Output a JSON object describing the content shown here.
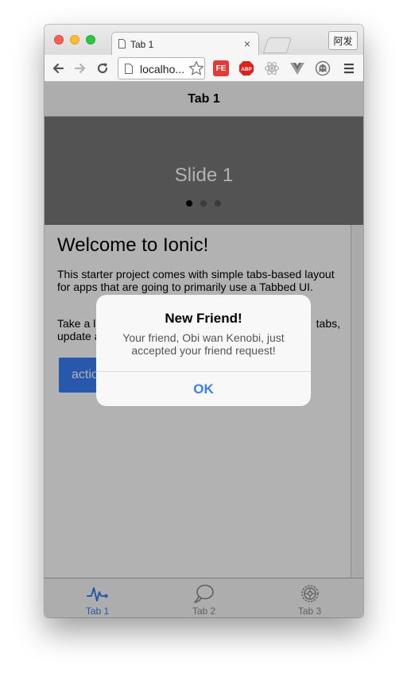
{
  "browser": {
    "tab_title": "Tab 1",
    "tab_close": "×",
    "user_button": "阿发",
    "url": "localho...",
    "ext_fe_label": "FE",
    "ext_abp_label": "ABP"
  },
  "app": {
    "header_title": "Tab 1",
    "slider": {
      "slide_label": "Slide 1",
      "active_index": 0,
      "count": 3
    },
    "content": {
      "heading": "Welcome to Ionic!",
      "paragraph1": "This starter project comes with simple tabs-based layout for apps that are going to primarily use a Tabbed UI.",
      "paragraph2_visible_left": "Take a lo",
      "paragraph2_visible_right": "tabs,",
      "paragraph2_line2_left": "update a",
      "action_button": "actio"
    },
    "tabs": [
      {
        "label": "Tab 1",
        "icon": "pulse-icon",
        "active": true
      },
      {
        "label": "Tab 2",
        "icon": "chat-bubbles-icon",
        "active": false
      },
      {
        "label": "Tab 3",
        "icon": "gear-icon",
        "active": false
      }
    ],
    "colors": {
      "primary": "#387ef5",
      "inactive_tab": "#8c8c8c",
      "slider_bg": "#777777"
    }
  },
  "alert": {
    "title": "New Friend!",
    "message": "Your friend, Obi wan Kenobi, just accepted your friend request!",
    "button": "OK"
  }
}
